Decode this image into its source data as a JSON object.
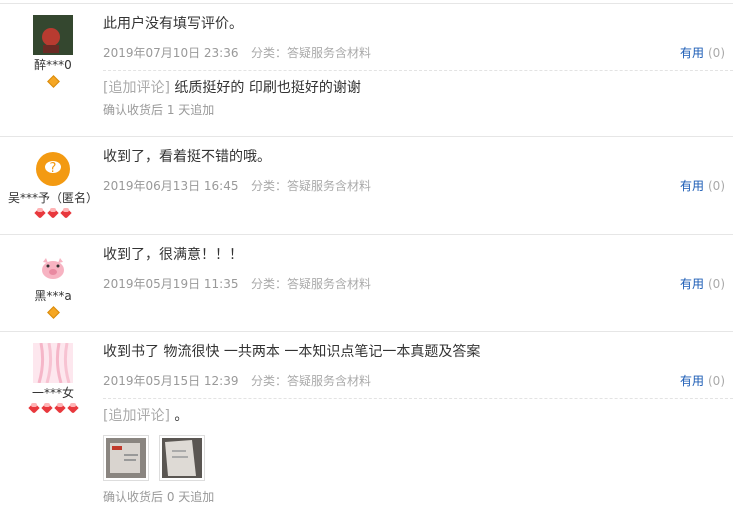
{
  "reviews": [
    {
      "user": "醉***0",
      "text": "此用户没有填写评价。",
      "date": "2019年07月10日 23:36",
      "category": "分类：答疑服务含材料",
      "useful_label": "有用",
      "useful_count": "(0)",
      "append_tag": "[追加评论]",
      "append_text": " 纸质挺好的 印刷也挺好的谢谢",
      "after": "确认收货后 1 天追加"
    },
    {
      "user": "吴***予（匿名）",
      "text": "收到了，看着挺不错的哦。",
      "date": "2019年06月13日 16:45",
      "category": "分类：答疑服务含材料",
      "useful_label": "有用",
      "useful_count": "(0)"
    },
    {
      "user": "黑***a",
      "text": "收到了，很满意！！！",
      "date": "2019年05月19日 11:35",
      "category": "分类：答疑服务含材料",
      "useful_label": "有用",
      "useful_count": "(0)"
    },
    {
      "user": "一***女",
      "text": "收到书了 物流很快 一共两本 一本知识点笔记一本真题及答案",
      "date": "2019年05月15日 12:39",
      "category": "分类：答疑服务含材料",
      "useful_label": "有用",
      "useful_count": "(0)",
      "append_tag": "[追加评论]",
      "append_text": " 。",
      "after": "确认收货后 0 天追加"
    }
  ]
}
